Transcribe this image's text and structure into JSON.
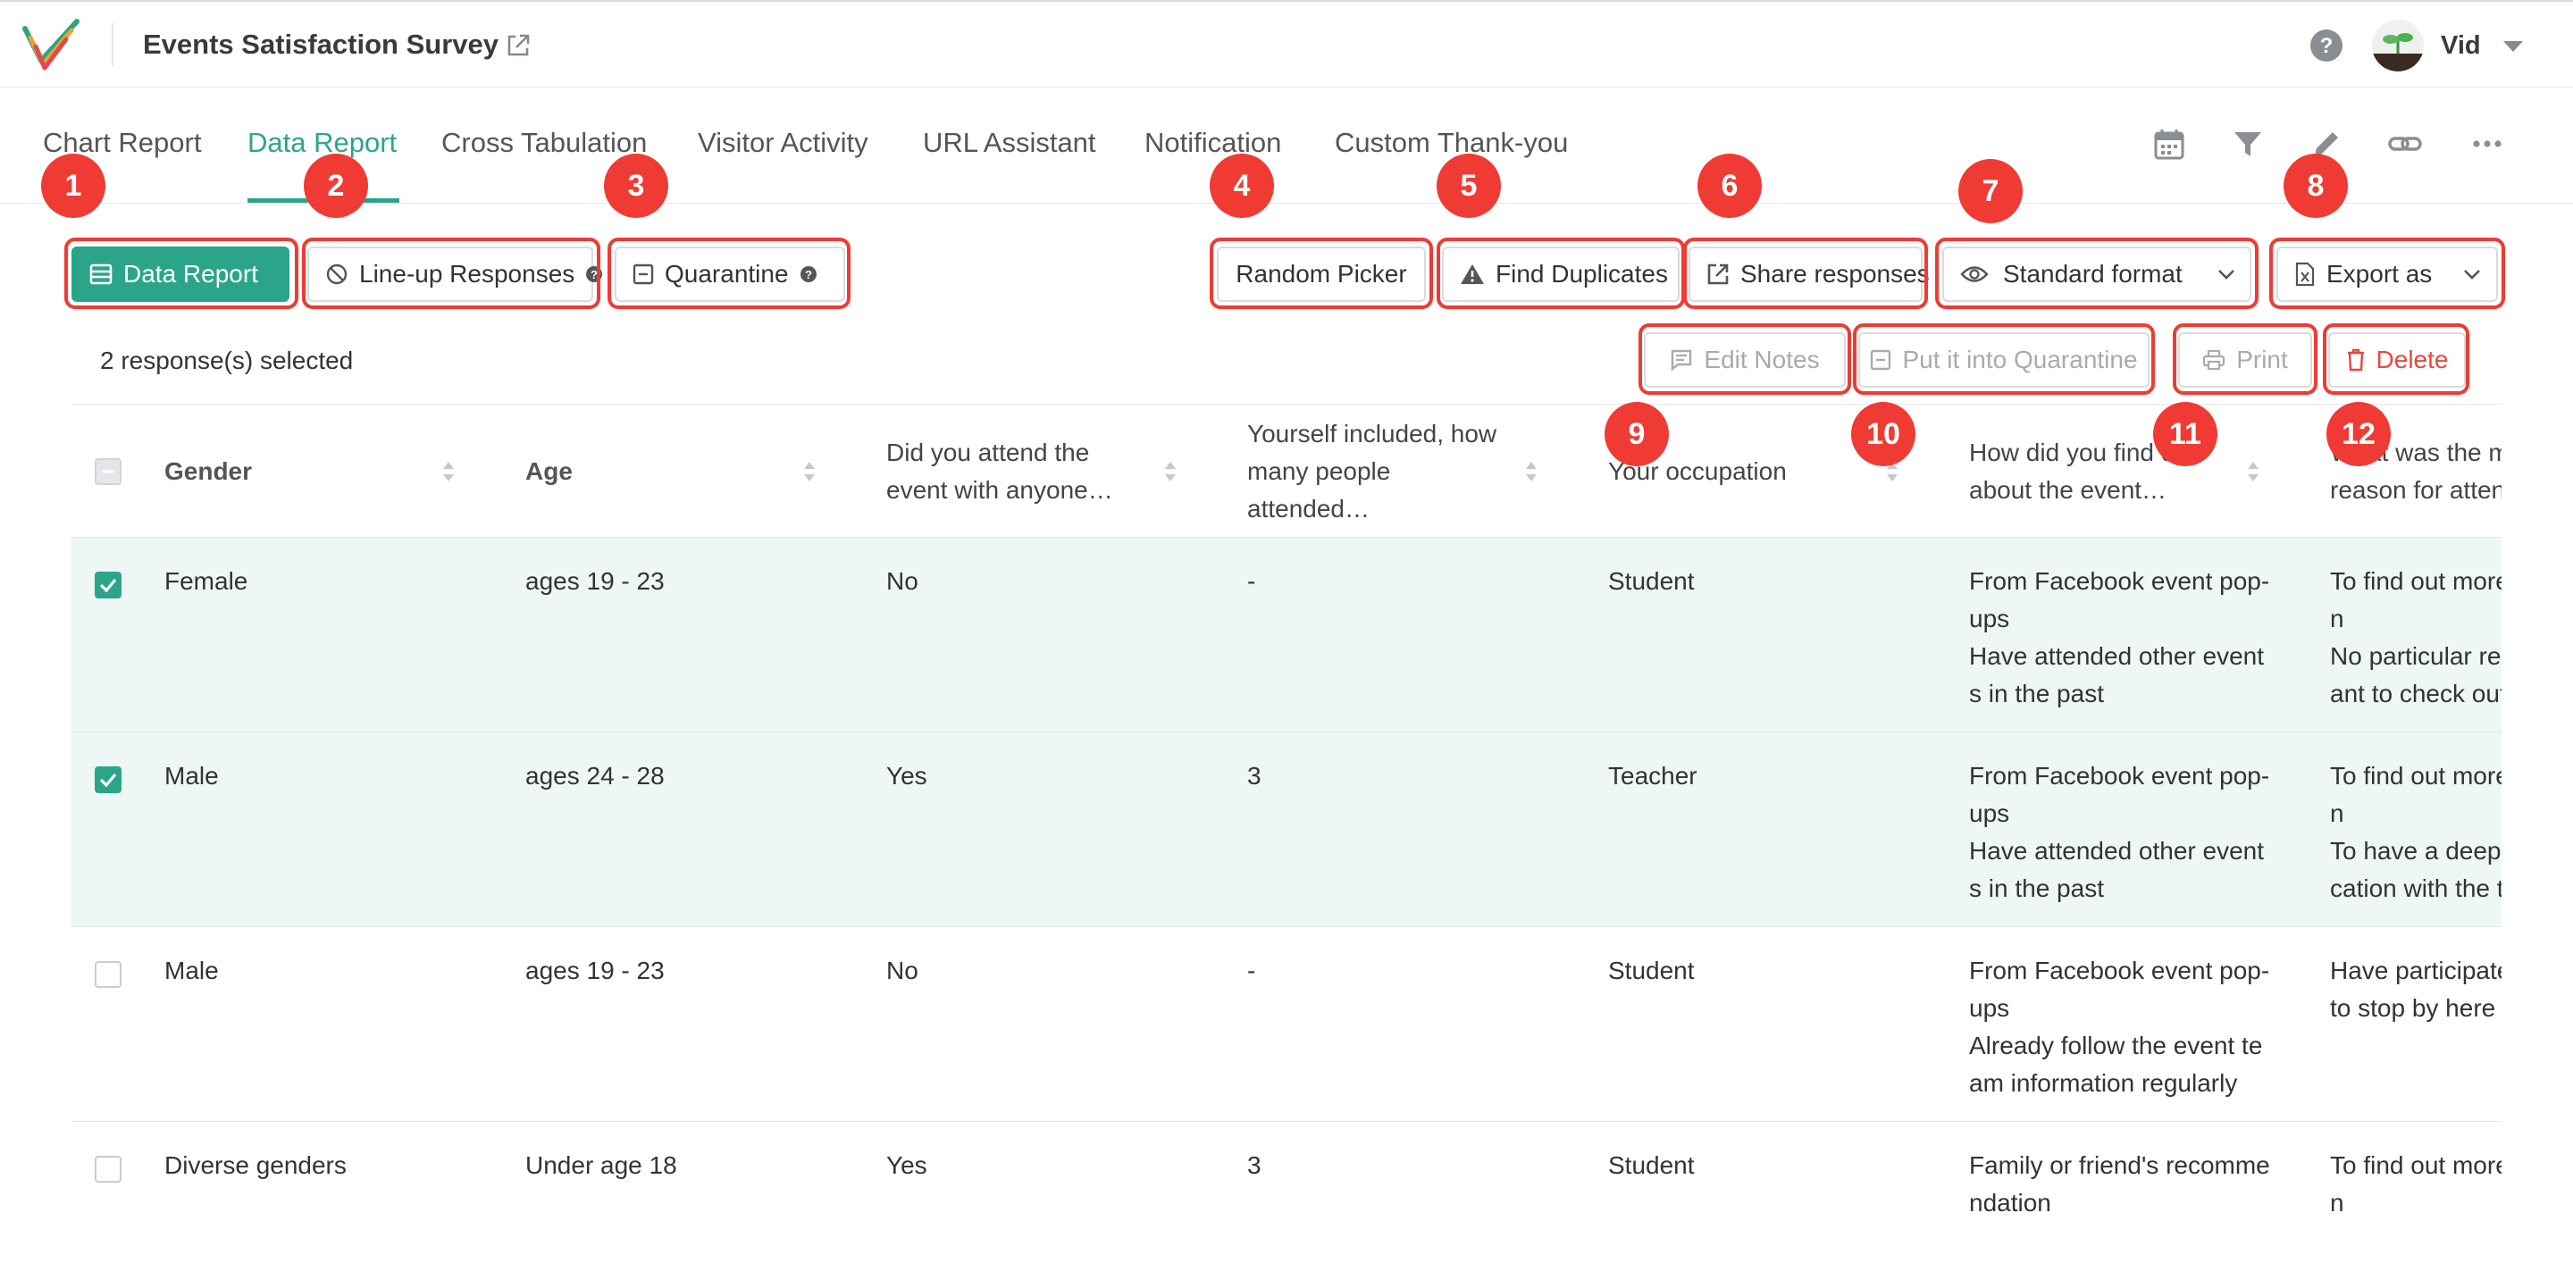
{
  "app": {
    "survey_title": "Events Satisfaction Survey",
    "user_name": "Vid"
  },
  "colors": {
    "accent": "#2ba58a",
    "highlight": "#ef3b33",
    "danger": "#e8473f"
  },
  "tabs": [
    {
      "label": "Chart Report"
    },
    {
      "label": "Data Report"
    },
    {
      "label": "Cross Tabulation"
    },
    {
      "label": "Visitor Activity"
    },
    {
      "label": "URL Assistant"
    },
    {
      "label": "Notification"
    },
    {
      "label": "Custom Thank-you"
    }
  ],
  "active_tab": "Data Report",
  "tab_tools": [
    "calendar-icon",
    "filter-icon",
    "pencil-icon",
    "link-icon",
    "more-icon"
  ],
  "toolbar": {
    "data_report": "Data Report",
    "lineup": "Line-up Responses",
    "quarantine": "Quarantine",
    "random_picker": "Random Picker",
    "find_duplicates": "Find Duplicates",
    "share_responses": "Share responses",
    "standard_format": "Standard format",
    "export_as": "Export as"
  },
  "selection": {
    "count_text": "2 response(s) selected",
    "edit_notes": "Edit Notes",
    "put_quarantine": "Put it into Quarantine",
    "print": "Print",
    "delete": "Delete"
  },
  "badges": [
    "1",
    "2",
    "3",
    "4",
    "5",
    "6",
    "7",
    "8",
    "9",
    "10",
    "11",
    "12"
  ],
  "table": {
    "columns": [
      "Gender",
      "Age",
      "Did you attend the event with anyone…",
      "Yourself included, how many people attended…",
      "Your occupation",
      "How did you find out about the event…",
      "What was the main reason for attending"
    ],
    "rows": [
      {
        "selected": true,
        "cells": [
          "Female",
          "ages 19 - 23",
          "No",
          "-",
          "Student",
          "From Facebook event pop-ups\nHave attended other events in the past",
          "To find out more information\nNo particular reason, just want to check out"
        ]
      },
      {
        "selected": true,
        "cells": [
          "Male",
          "ages 24 - 28",
          "Yes",
          "3",
          "Teacher",
          "From Facebook event pop-ups\nHave attended other events in the past",
          "To find out more information\nTo have a deeper communication with the team"
        ]
      },
      {
        "selected": false,
        "cells": [
          "Male",
          "ages 19 - 23",
          "No",
          "-",
          "Student",
          "From Facebook event pop-ups\nAlready follow the event team information regularly",
          "Have participated and want to stop by here as well"
        ]
      },
      {
        "selected": false,
        "cells": [
          "Diverse genders",
          "Under age 18",
          "Yes",
          "3",
          "Student",
          "Family or friend's recommendation",
          "To find out more information"
        ]
      }
    ]
  }
}
